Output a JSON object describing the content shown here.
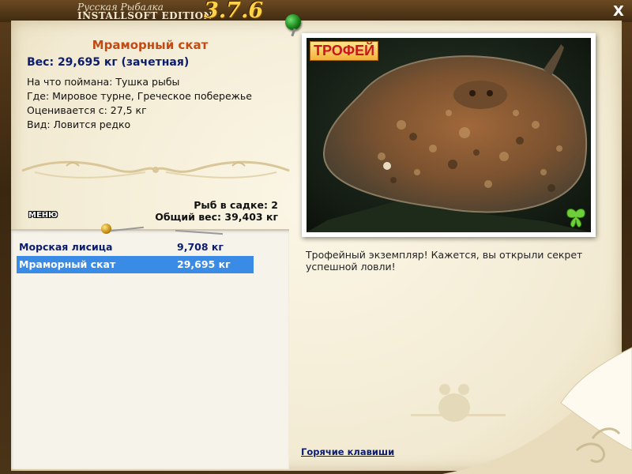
{
  "window": {
    "title_top": "Русская Рыбалка",
    "title_main": "INSTALLSOFT EDITION",
    "version": "3.7.6",
    "close_label": "X"
  },
  "fish": {
    "name": "Мраморный скат",
    "weight": "Вес: 29,695 кг (зачетная)",
    "caught_on": "На что поймана: Тушка рыбы",
    "location": "Где: Мировое турне, Греческое побережье",
    "valued_from": "Оценивается с: 27,5 кг",
    "kind": "Вид: Ловится редко"
  },
  "menu_label": "МЕНЮ",
  "stats": {
    "count": "Рыб в садке: 2",
    "total": "Общий вес: 39,403 кг"
  },
  "catch_list": [
    {
      "name": "Морская лисица",
      "weight": "9,708 кг",
      "selected": false
    },
    {
      "name": "Мраморный скат",
      "weight": "29,695 кг",
      "selected": true
    }
  ],
  "photo": {
    "badge": "ТРОФЕЙ"
  },
  "description": "Трофейный экземпляр! Кажется, вы открыли секрет успешной ловли!",
  "hotkeys_label": "Горячие клавиши",
  "colors": {
    "fish_name": "#c24a14",
    "weight": "#0c1c6e",
    "selected_row": "#3a8be6",
    "version": "#ffd24a"
  }
}
